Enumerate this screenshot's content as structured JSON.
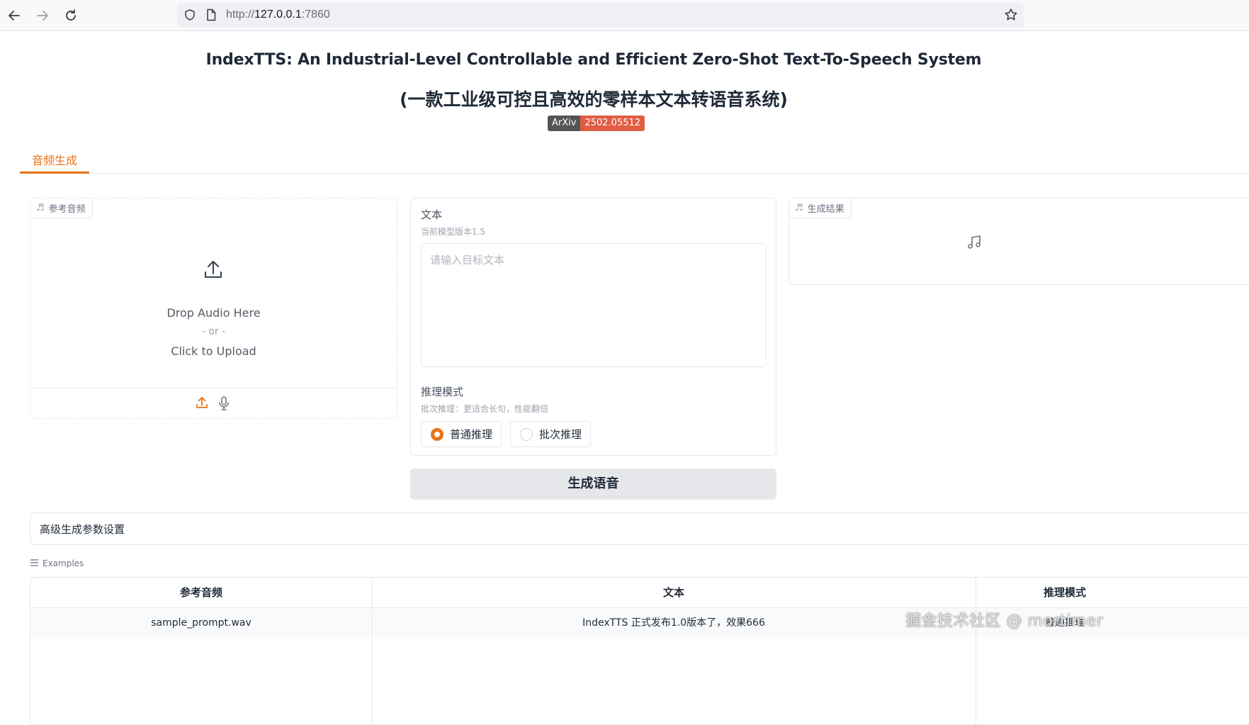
{
  "browser": {
    "url_scheme": "http://",
    "url_host": "127.0.0.1",
    "url_port": ":7860"
  },
  "header": {
    "title": "IndexTTS: An Industrial-Level Controllable and Efficient Zero-Shot Text-To-Speech System",
    "subtitle": "(一款工业级可控且高效的零样本文本转语音系统)",
    "badge_left": "ArXiv",
    "badge_right": "2502.05512"
  },
  "tabs": [
    {
      "label": "音频生成"
    }
  ],
  "reference_audio": {
    "label": "参考音频",
    "drop_text": "Drop Audio Here",
    "or_text": "- or -",
    "upload_text": "Click to Upload"
  },
  "text_panel": {
    "label": "文本",
    "info": "当前模型版本1.5",
    "placeholder": "请输入目标文本",
    "mode_label": "推理模式",
    "mode_info": "批次推理：更适合长句，性能翻倍",
    "options": [
      {
        "label": "普通推理",
        "selected": true
      },
      {
        "label": "批次推理",
        "selected": false
      }
    ]
  },
  "generate_button": "生成语音",
  "output": {
    "label": "生成结果"
  },
  "advanced": {
    "label": "高级生成参数设置"
  },
  "examples": {
    "label": "Examples",
    "headers": [
      "参考音频",
      "文本",
      "推理模式"
    ],
    "rows": [
      [
        "sample_prompt.wav",
        "IndexTTS 正式发布1.0版本了，效果666",
        "普通推理"
      ]
    ]
  },
  "watermark": "掘金技术社区 @ mortimer",
  "colors": {
    "accent": "#ea7317",
    "badge_left": "#555555",
    "badge_right": "#e05d44",
    "button_bg": "#e5e7eb"
  }
}
